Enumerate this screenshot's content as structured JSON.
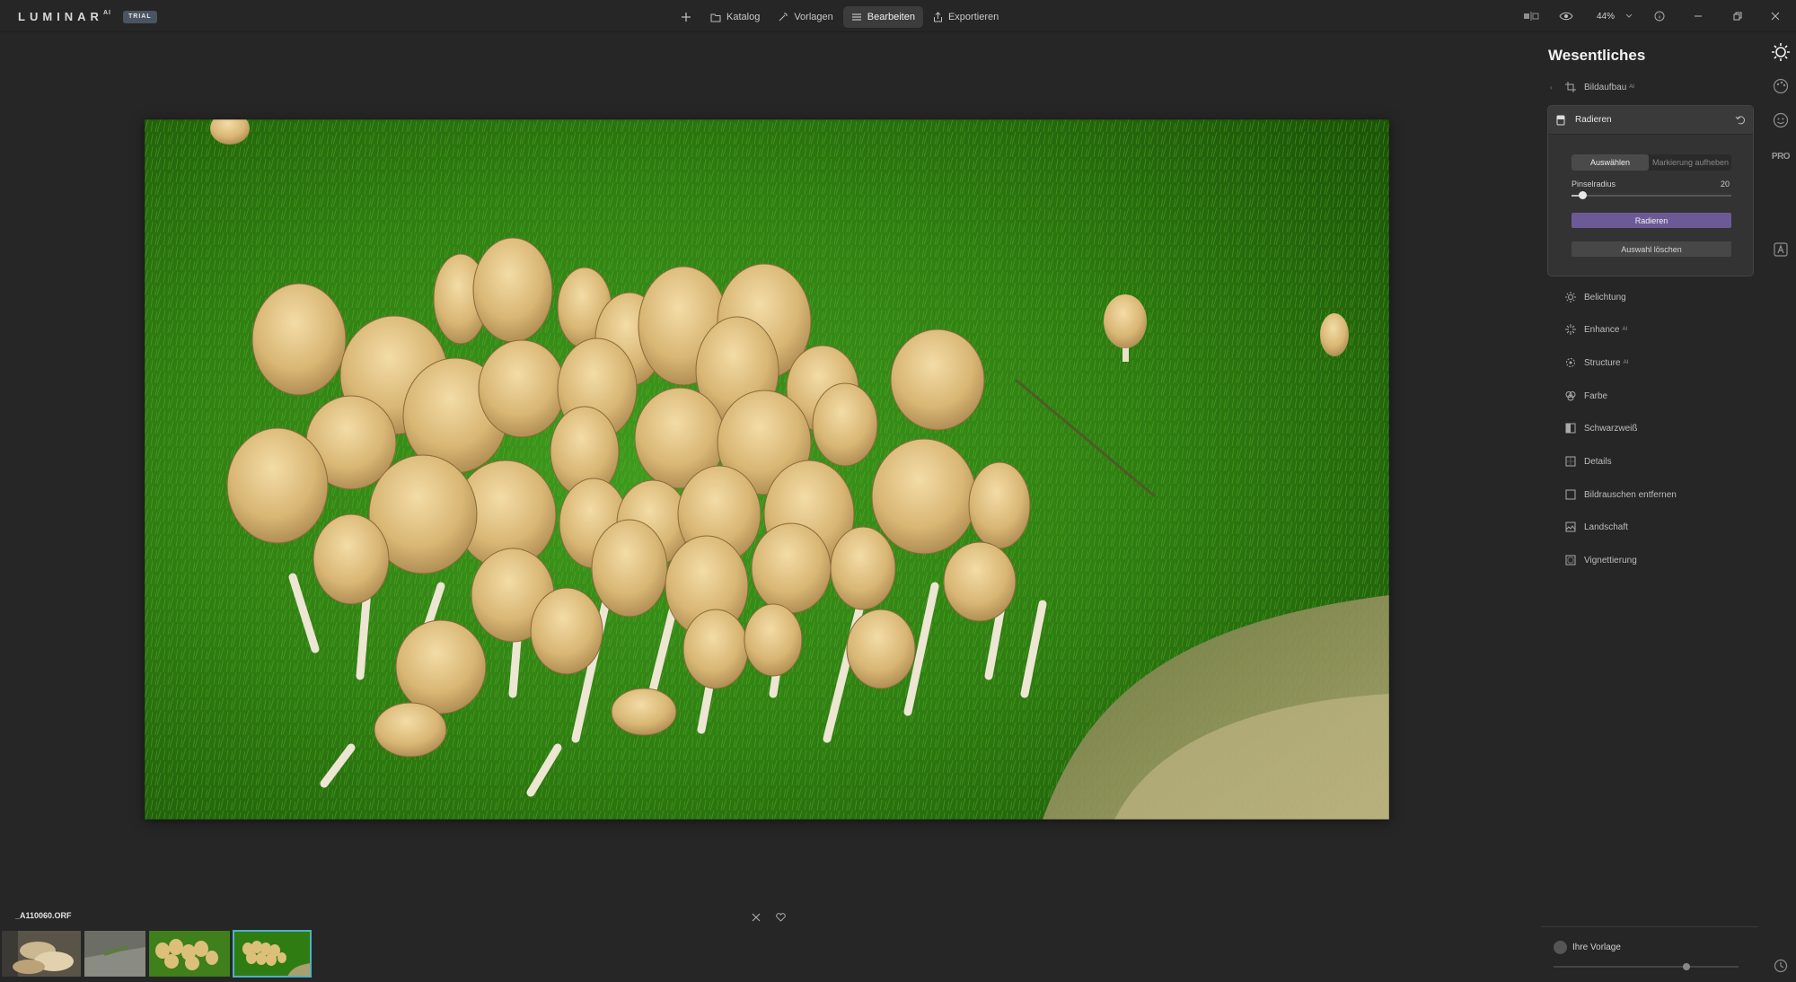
{
  "app": {
    "logo": "LUMINAR",
    "logo_sup": "AI",
    "badge": "TRIAL"
  },
  "nav": {
    "add": "+",
    "items": [
      {
        "label": "Katalog",
        "icon": "folder-icon",
        "active": false
      },
      {
        "label": "Vorlagen",
        "icon": "magic-wand-icon",
        "active": false
      },
      {
        "label": "Bearbeiten",
        "icon": "sliders-icon",
        "active": true
      },
      {
        "label": "Exportieren",
        "icon": "share-icon",
        "active": false
      }
    ]
  },
  "toolbar_right": {
    "zoom": "44%"
  },
  "panel": {
    "title": "Wesentliches",
    "bildaufbau": {
      "label": "Bildaufbau",
      "ai": "AI"
    },
    "radieren": {
      "title": "Radieren",
      "seg_select": "Auswählen",
      "seg_unmark": "Markierung aufheben",
      "slider_label": "Pinselradius",
      "slider_value": "20",
      "slider_fraction": 0.07,
      "button_primary": "Radieren",
      "button_clear": "Auswahl löschen"
    },
    "tools": [
      {
        "label": "Belichtung",
        "ai": "",
        "icon": "sun-icon"
      },
      {
        "label": "Enhance",
        "ai": "AI",
        "icon": "sparkle-icon"
      },
      {
        "label": "Structure",
        "ai": "AI",
        "icon": "structure-icon"
      },
      {
        "label": "Farbe",
        "ai": "",
        "icon": "palette-icon"
      },
      {
        "label": "Schwarzweiß",
        "ai": "",
        "icon": "bw-icon"
      },
      {
        "label": "Details",
        "ai": "",
        "icon": "details-icon"
      },
      {
        "label": "Bildrauschen entfernen",
        "ai": "",
        "icon": "noise-icon"
      },
      {
        "label": "Landschaft",
        "ai": "",
        "icon": "landscape-icon"
      },
      {
        "label": "Vignettierung",
        "ai": "",
        "icon": "vignette-icon"
      }
    ],
    "preset_label": "Ihre Vorlage",
    "preset_fraction": 0.72
  },
  "strip": {
    "pro": "PRO"
  },
  "filmstrip": {
    "filename": "_A110060.ORF",
    "thumbs": 4,
    "active_index": 3
  }
}
